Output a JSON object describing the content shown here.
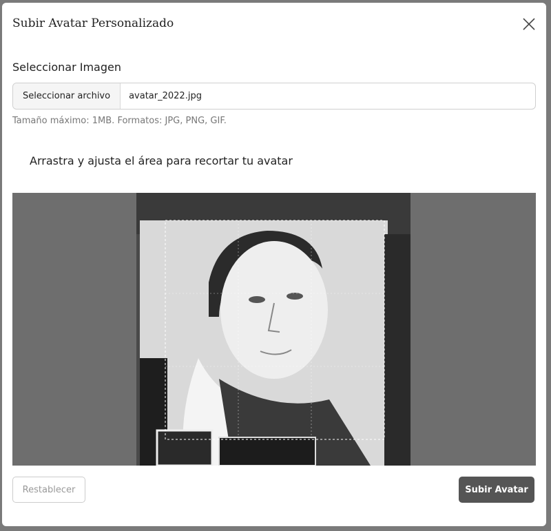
{
  "modal": {
    "title": "Subir Avatar Personalizado",
    "close_icon": "close-icon"
  },
  "file_field": {
    "label": "Seleccionar Imagen",
    "button_label": "Seleccionar archivo",
    "file_name": "avatar_2022.jpg",
    "help_text": "Tamaño máximo: 1MB. Formatos: JPG, PNG, GIF."
  },
  "cropper": {
    "instruction": "Arrastra y ajusta el área para recortar tu avatar"
  },
  "footer": {
    "reset_label": "Restablecer",
    "upload_label": "Subir Avatar"
  },
  "colors": {
    "primary_button": "#555555",
    "overlay": "#6e6e6e"
  }
}
